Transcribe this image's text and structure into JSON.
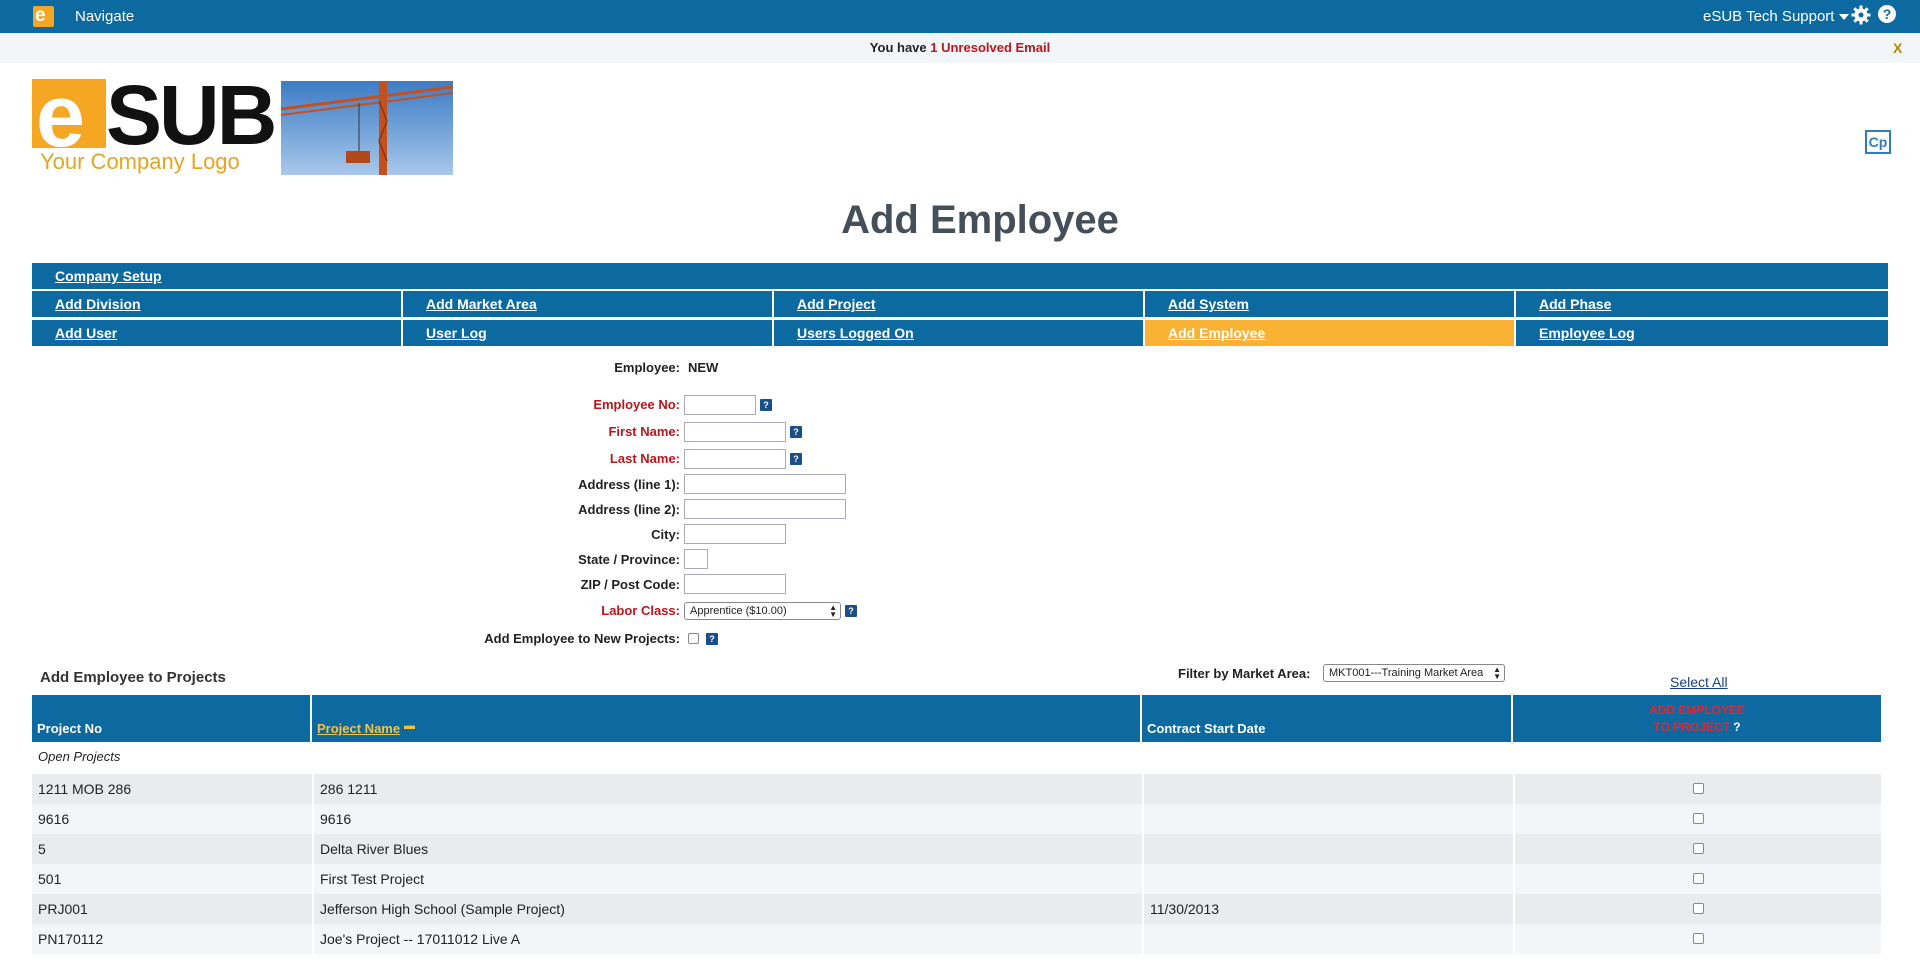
{
  "topbar": {
    "logo_letter": "e",
    "navigate": "Navigate",
    "user": "eSUB Tech Support"
  },
  "notice": {
    "prefix": "You have ",
    "count": "1",
    "suffix": " Unresolved Email",
    "close": "X"
  },
  "brand": {
    "e": "e",
    "sub": "SUB",
    "tagline": "Your Company Logo",
    "cp": "Cp"
  },
  "page_title": "Add Employee",
  "menu": {
    "company_setup": "Company Setup",
    "row1": [
      "Add Division",
      "Add Market Area",
      "Add Project",
      "Add System",
      "Add Phase"
    ],
    "row2": [
      "Add User",
      "User Log",
      "Users Logged On",
      "Add Employee",
      "Employee Log"
    ]
  },
  "form": {
    "employee_label": "Employee:",
    "employee_value": "NEW",
    "employee_no": "Employee No:",
    "first_name": "First Name:",
    "last_name": "Last Name:",
    "address1": "Address (line 1):",
    "address2": "Address (line 2):",
    "city": "City:",
    "state": "State / Province:",
    "zip": "ZIP / Post Code:",
    "labor_class": "Labor Class:",
    "labor_class_value": "Apprentice ($10.00)",
    "add_to_new": "Add Employee to New Projects:",
    "help": "?"
  },
  "projects": {
    "title": "Add Employee to Projects",
    "filter_label": "Filter by Market Area:",
    "filter_value": "MKT001---Training Market Area",
    "select_all": "Select All",
    "headers": {
      "no": "Project No",
      "name": "Project Name",
      "start": "Contract Start Date",
      "add_line1": "ADD EMPLOYEE",
      "add_line2": "TO PROJECT",
      "q": "?"
    },
    "group_label": "Open Projects",
    "rows": [
      {
        "no": "1211 MOB 286",
        "name": "286 1211",
        "start": ""
      },
      {
        "no": "9616",
        "name": "9616",
        "start": ""
      },
      {
        "no": "5",
        "name": "Delta River Blues",
        "start": ""
      },
      {
        "no": "501",
        "name": "First Test Project",
        "start": ""
      },
      {
        "no": "PRJ001",
        "name": "Jefferson High School (Sample Project)",
        "start": "11/30/2013"
      },
      {
        "no": "PN170112",
        "name": "Joe's Project -- 17011012 Live A",
        "start": ""
      }
    ]
  }
}
